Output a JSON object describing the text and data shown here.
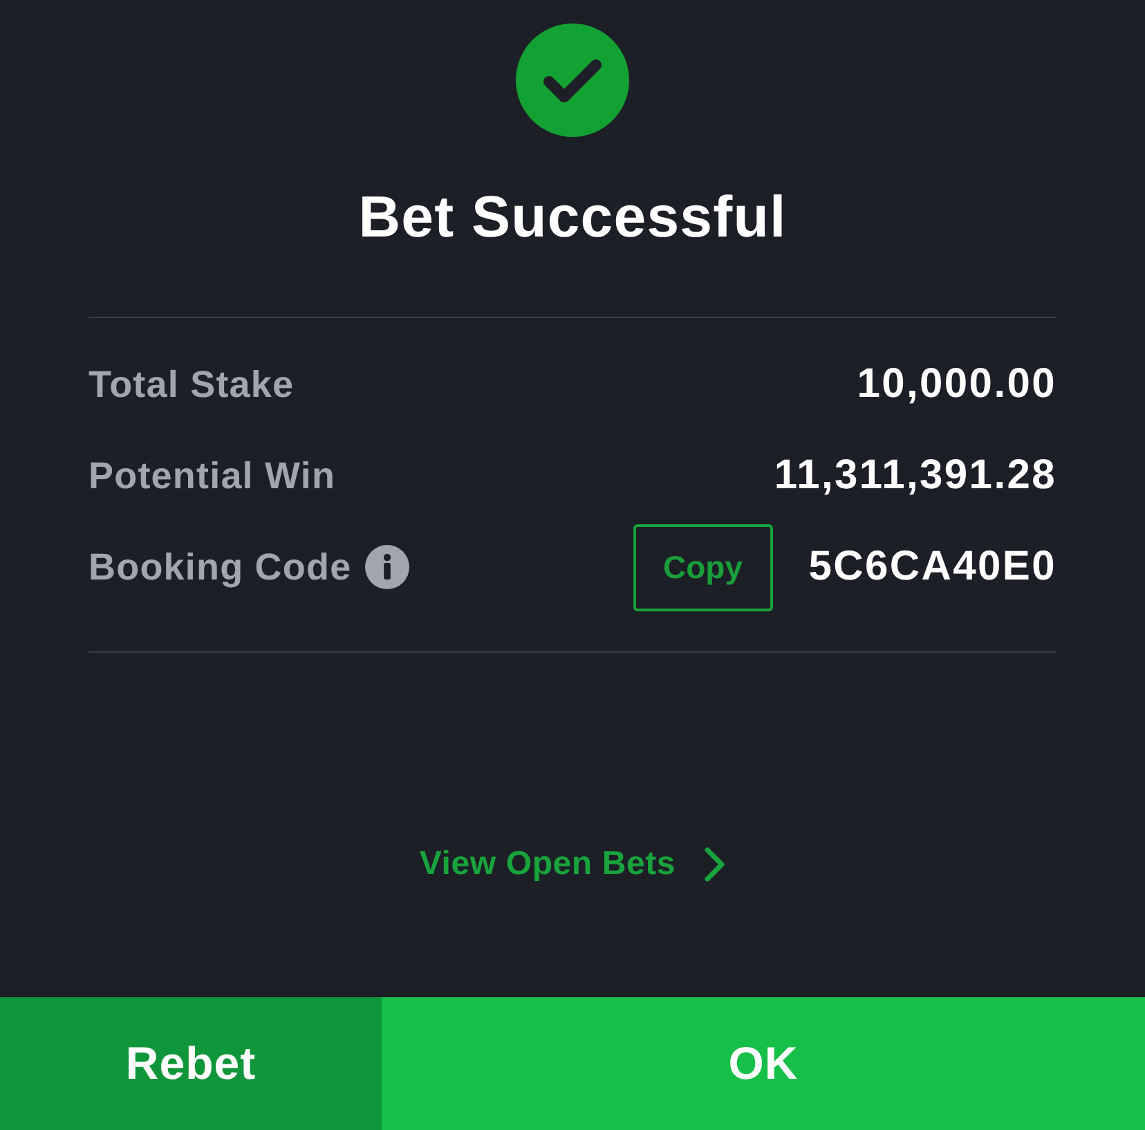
{
  "header": {
    "title": "Bet Successful"
  },
  "summary": [
    {
      "kind": "amount",
      "label": "Total Stake",
      "value": "10,000.00",
      "info": false
    },
    {
      "kind": "amount",
      "label": "Potential Win",
      "value": "11,311,391.28",
      "info": false
    },
    {
      "kind": "code",
      "label": "Booking Code",
      "value": "5C6CA40E0",
      "info": true,
      "action": "Copy"
    }
  ],
  "link": {
    "label": "View Open Bets"
  },
  "buttons": [
    {
      "label": "Rebet",
      "kind": "secondary"
    },
    {
      "label": "OK",
      "kind": "primary"
    }
  ]
}
